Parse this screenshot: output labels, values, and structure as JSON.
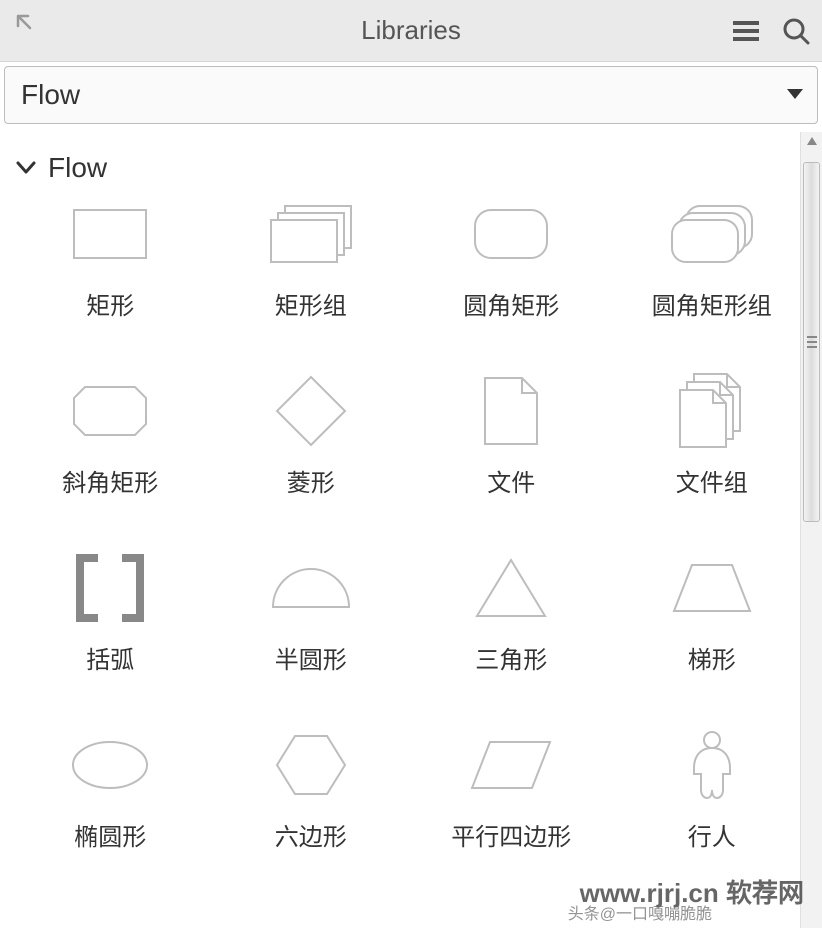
{
  "header": {
    "title": "Libraries"
  },
  "dropdown": {
    "selected": "Flow"
  },
  "section": {
    "title": "Flow"
  },
  "shapes": [
    {
      "id": "rectangle",
      "label": "矩形"
    },
    {
      "id": "rectangle-group",
      "label": "矩形组"
    },
    {
      "id": "rounded-rectangle",
      "label": "圆角矩形"
    },
    {
      "id": "rounded-rectangle-group",
      "label": "圆角矩形组"
    },
    {
      "id": "bevel-rectangle",
      "label": "斜角矩形"
    },
    {
      "id": "diamond",
      "label": "菱形"
    },
    {
      "id": "file",
      "label": "文件"
    },
    {
      "id": "file-group",
      "label": "文件组"
    },
    {
      "id": "brackets",
      "label": "括弧"
    },
    {
      "id": "semicircle",
      "label": "半圆形"
    },
    {
      "id": "triangle",
      "label": "三角形"
    },
    {
      "id": "trapezoid",
      "label": "梯形"
    },
    {
      "id": "ellipse",
      "label": "椭圆形"
    },
    {
      "id": "hexagon",
      "label": "六边形"
    },
    {
      "id": "parallelogram",
      "label": "平行四边形"
    },
    {
      "id": "person",
      "label": "行人"
    }
  ],
  "watermark": "www.rjrj.cn 软荐网",
  "watermark2": "头条@一口嘎嘣脆脆"
}
